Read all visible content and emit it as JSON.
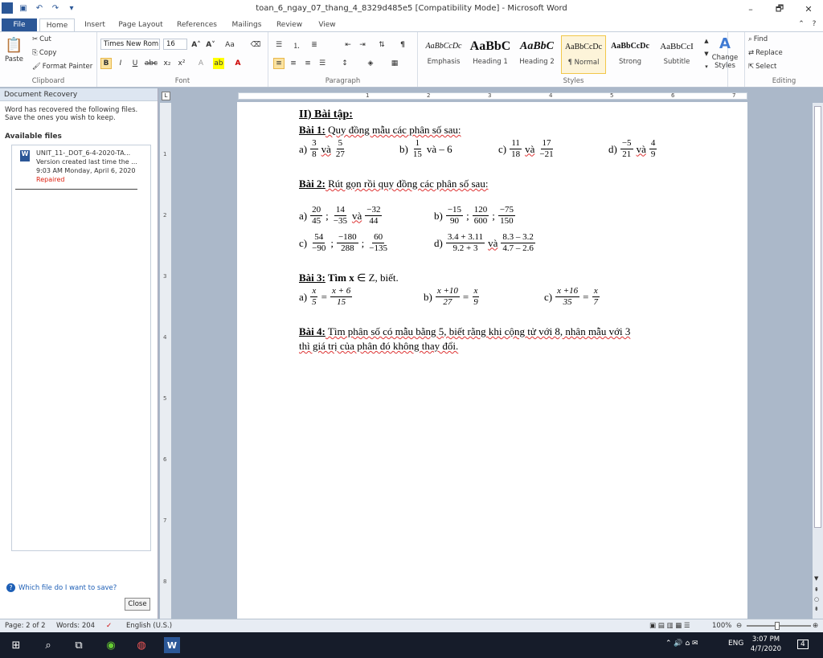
{
  "window": {
    "title": "toan_6_ngay_07_thang_4_8329d485e5 [Compatibility Mode] - Microsoft Word",
    "minimize": "–",
    "restore": "🗗",
    "close": "✕"
  },
  "tabs": [
    "File",
    "Home",
    "Insert",
    "Page Layout",
    "References",
    "Mailings",
    "Review",
    "View"
  ],
  "clipboard": {
    "paste": "Paste",
    "cut": "Cut",
    "copy": "Copy",
    "format_painter": "Format Painter",
    "label": "Clipboard"
  },
  "font": {
    "name": "Times New Rom",
    "size": "16",
    "label": "Font"
  },
  "paragraph": {
    "label": "Paragraph"
  },
  "styles": {
    "label": "Styles",
    "items": [
      {
        "preview": "AaBbCcDc",
        "name": "Emphasis"
      },
      {
        "preview": "AaBbC",
        "name": "Heading 1"
      },
      {
        "preview": "AaBbC",
        "name": "Heading 2"
      },
      {
        "preview": "AaBbCcDc",
        "name": "¶ Normal"
      },
      {
        "preview": "AaBbCcDc",
        "name": "Strong"
      },
      {
        "preview": "AaBbCcI",
        "name": "Subtitle"
      }
    ],
    "change_styles": "Change Styles"
  },
  "editing": {
    "find": "Find",
    "replace": "Replace",
    "select": "Select",
    "label": "Editing"
  },
  "recovery": {
    "header": "Document Recovery",
    "intro": "Word has recovered the following files.  Save the ones you wish to keep.",
    "available": "Available files",
    "file_name": "UNIT_11-_DOT_6-4-2020-TA...",
    "file_version": "Version created last time the ...",
    "file_time": "9:03 AM Monday, April 6, 2020",
    "file_status": "Repaired",
    "help": "Which file do I want to save?",
    "close": "Close"
  },
  "document": {
    "heading": "II)  Bài tập:",
    "b1_label": "Bài 1:",
    "b1_text": " Quy đồng mẫu các phân số sau:",
    "b2_label": "Bài 2:",
    "b2_text": " Rút gọn rồi quy đồng các phân số sau:",
    "b3_label": "Bài 3:",
    "b3_text_bold": " Tìm x",
    "b3_text": " ∈ Z, biết.",
    "b4_label": "Bài 4:",
    "b4_line1": " Tìm phân số có mẫu bằng 5, biết rằng khi cộng tử với 8, nhân mẫu với 3",
    "b4_line2": "thì giá trị của phân đó không thay đổi.",
    "va": "và",
    "b1": {
      "a": "a)",
      "a_n1": "3",
      "a_d1": "8",
      "a_n2": "5",
      "a_d2": "27",
      "b": "b)",
      "b_n1": "1",
      "b_d1": "15",
      "b_rest": "và – 6",
      "c": "c)",
      "c_n1": "11",
      "c_d1": "18",
      "c_n2": "17",
      "c_d2": "−21",
      "d": "d)",
      "d_n1": "−5",
      "d_d1": "21",
      "d_n2": "4",
      "d_d2": "9"
    },
    "b2": {
      "a": "a)",
      "a_n1": "20",
      "a_d1": "45",
      "a_n2": "14",
      "a_d2": "−35",
      "a_n3": "−32",
      "a_d3": "44",
      "b": "b)",
      "b_n1": "−15",
      "b_d1": "90",
      "b_n2": "120",
      "b_d2": "600",
      "b_n3": "−75",
      "b_d3": "150",
      "c": "c)",
      "c_n1": "54",
      "c_d1": "−90",
      "c_n2": "−180",
      "c_d2": "288",
      "c_n3": "60",
      "c_d3": "−135",
      "d": "d)",
      "d_n1": "3.4 + 3.11",
      "d_d1": "9.2 + 3",
      "d_n2": "8.3 – 3.2",
      "d_d2": "4.7 – 2.6",
      "sep": ";"
    },
    "b3": {
      "a": "a)",
      "a_n1": "x",
      "a_d1": "5",
      "a_n2": "x + 6",
      "a_d2": "15",
      "b": "b)",
      "b_n1": "x +10",
      "b_d1": "27",
      "b_n2": "x",
      "b_d2": "9",
      "c": "c)",
      "c_n1": "x +16",
      "c_d1": "35",
      "c_n2": "x",
      "c_d2": "7",
      "eq": "="
    }
  },
  "status": {
    "page": "Page: 2 of 2",
    "words": "Words: 204",
    "language": "English (U.S.)",
    "zoom": "100%"
  },
  "taskbar": {
    "lang": "ENG",
    "time": "3:07 PM",
    "date": "4/7/2020",
    "notifications": "4"
  }
}
